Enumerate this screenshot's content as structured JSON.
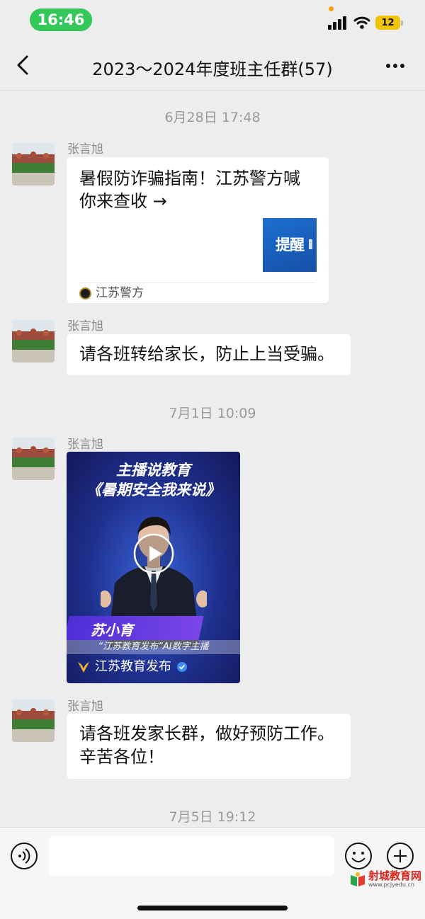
{
  "status_bar": {
    "time": "16:46",
    "battery": "12"
  },
  "nav": {
    "title": "2023～2024年度班主任群(57)"
  },
  "messages": [
    {
      "timestamp": "6月28日 17:48",
      "sender": "张言旭",
      "card": {
        "title": "暑假防诈骗指南！江苏警方喊你来查收 →",
        "thumb_text": "提醒",
        "source": "江苏警方"
      }
    },
    {
      "sender": "张言旭",
      "text": "请各班转给家长，防止上当受骗。"
    },
    {
      "timestamp": "7月1日 10:09",
      "sender": "张言旭",
      "video": {
        "title_line1": "主播说教育",
        "title_line2": "《暑期安全我来说》",
        "presenter_name": "苏小育",
        "presenter_subtitle": "“江苏教育发布”AI数字主播",
        "channel": "江苏教育发布"
      }
    },
    {
      "sender": "张言旭",
      "text_line1": "请各班发家长群，做好预防工作。",
      "text_line2": "辛苦各位！"
    },
    {
      "timestamp": "7月5日 19:12"
    }
  ],
  "input": {
    "placeholder": ""
  },
  "watermark": {
    "title": "射城教育网",
    "url": "www.pcjyedu.cn"
  },
  "colors": {
    "background": "#ededed",
    "time_pill": "#34c759",
    "battery": "#f0c400",
    "watermark": "#d9261c"
  }
}
